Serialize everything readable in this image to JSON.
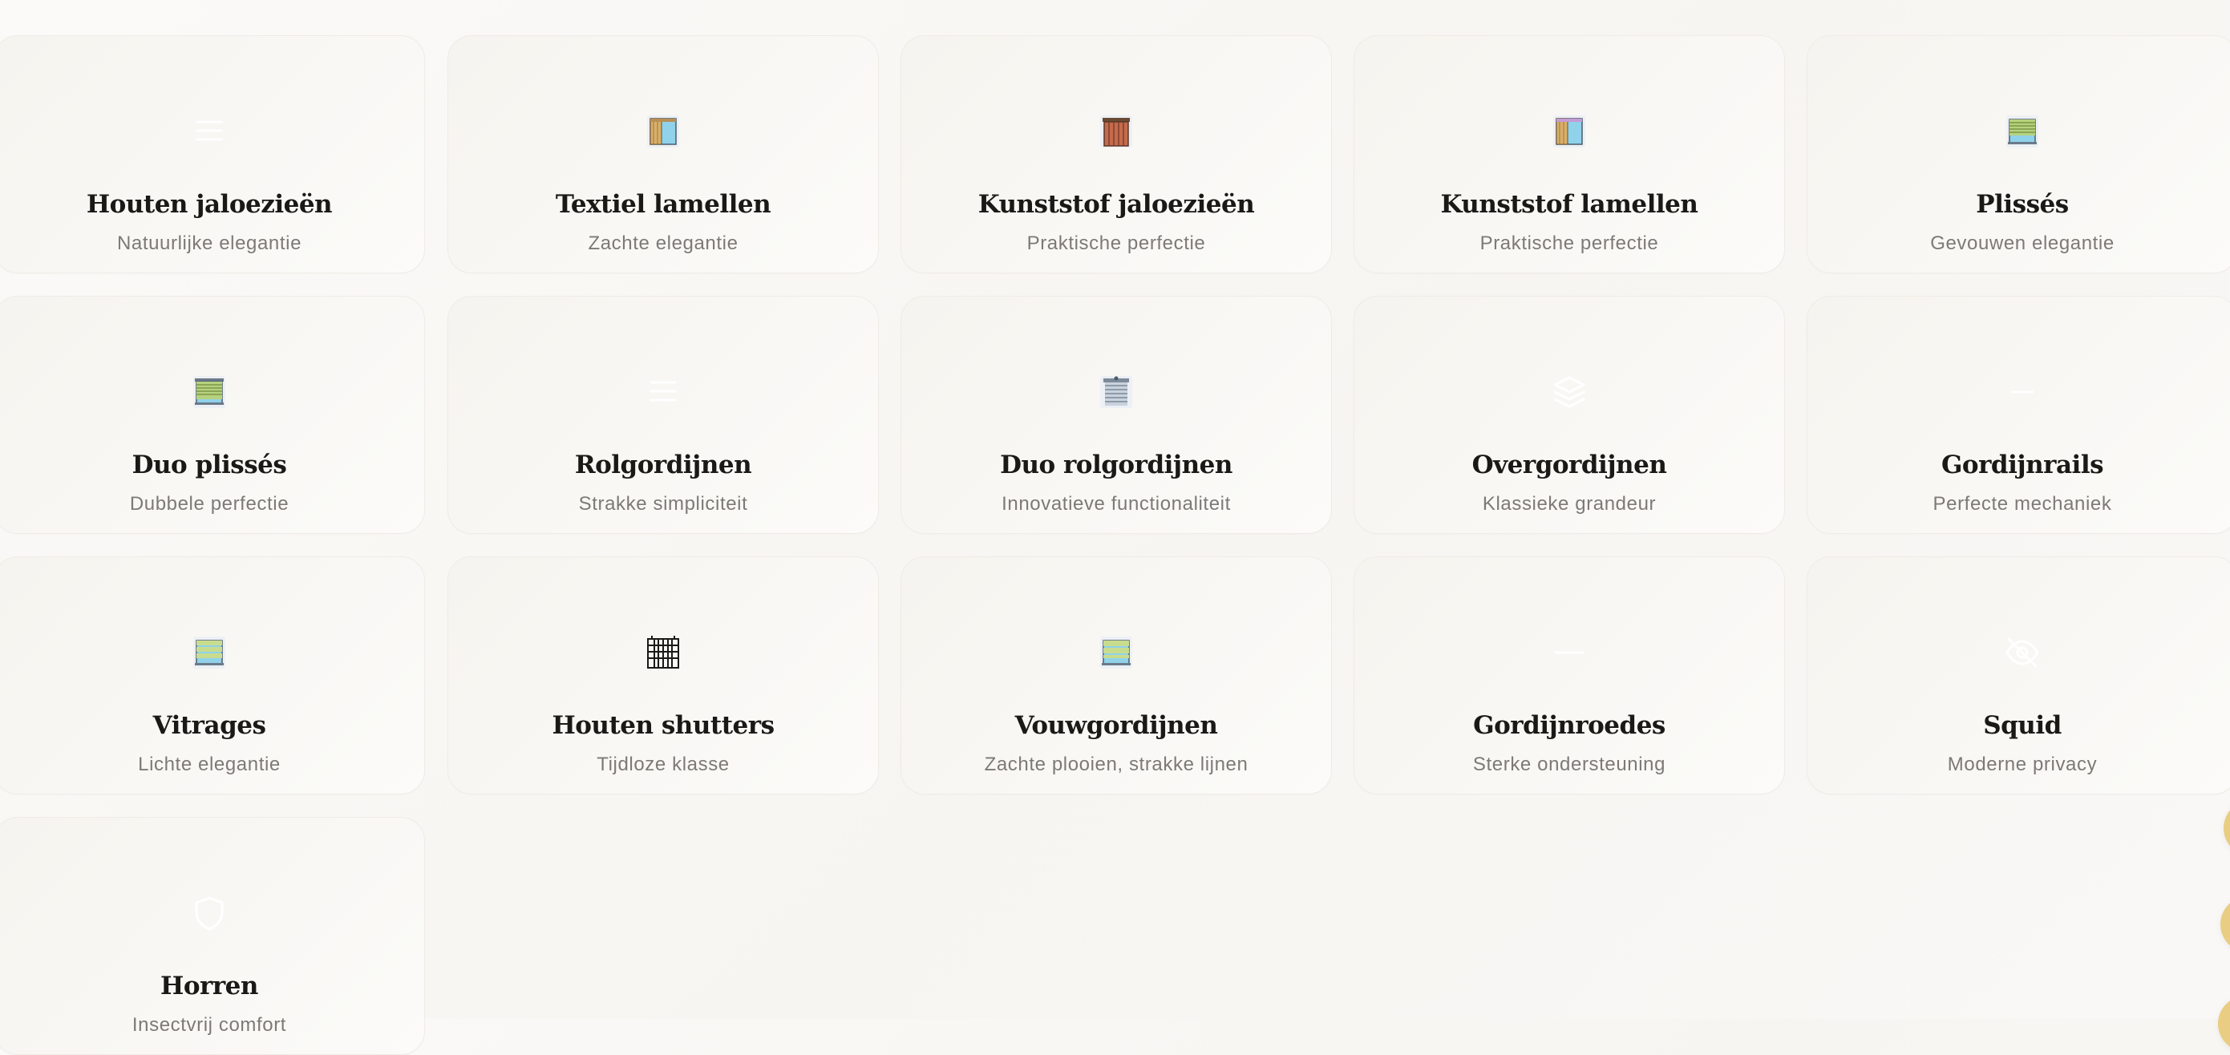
{
  "cards": [
    {
      "title": "Houten jaloezieën",
      "subtitle": "Natuurlijke elegantie",
      "icon": "blinds-lines-icon"
    },
    {
      "title": "Textiel lamellen",
      "subtitle": "Zachte elegantie",
      "icon": "vertical-blinds-window-icon"
    },
    {
      "title": "Kunststof jaloezieën",
      "subtitle": "Praktische perfectie",
      "icon": "wood-slat-blinds-icon"
    },
    {
      "title": "Kunststof lamellen",
      "subtitle": "Praktische perfectie",
      "icon": "vertical-blinds-window-icon"
    },
    {
      "title": "Plissés",
      "subtitle": "Gevouwen elegantie",
      "icon": "pleated-blinds-icon"
    },
    {
      "title": "Duo plissés",
      "subtitle": "Dubbele perfectie",
      "icon": "duo-pleated-blinds-icon"
    },
    {
      "title": "Rolgordijnen",
      "subtitle": "Strakke simpliciteit",
      "icon": "blinds-lines-icon"
    },
    {
      "title": "Duo rolgordijnen",
      "subtitle": "Innovatieve functionaliteit",
      "icon": "roller-blind-icon"
    },
    {
      "title": "Overgordijnen",
      "subtitle": "Klassieke grandeur",
      "icon": "layers-icon"
    },
    {
      "title": "Gordijnrails",
      "subtitle": "Perfecte mechaniek",
      "icon": "rail-line-icon"
    },
    {
      "title": "Vitrages",
      "subtitle": "Lichte elegantie",
      "icon": "sheer-curtain-icon"
    },
    {
      "title": "Houten shutters",
      "subtitle": "Tijdloze klasse",
      "icon": "shutters-icon"
    },
    {
      "title": "Vouwgordijnen",
      "subtitle": "Zachte plooien, strakke lijnen",
      "icon": "roman-shade-icon"
    },
    {
      "title": "Gordijnroedes",
      "subtitle": "Sterke ondersteuning",
      "icon": "rod-line-icon"
    },
    {
      "title": "Squid",
      "subtitle": "Moderne privacy",
      "icon": "eye-off-icon"
    },
    {
      "title": "Horren",
      "subtitle": "Insectvrij comfort",
      "icon": "shield-icon"
    }
  ],
  "colors": {
    "accent": "#e8cd83",
    "title": "#1b1916",
    "subtitle": "#7d7a76",
    "card_bg": "#f7f5f1"
  }
}
